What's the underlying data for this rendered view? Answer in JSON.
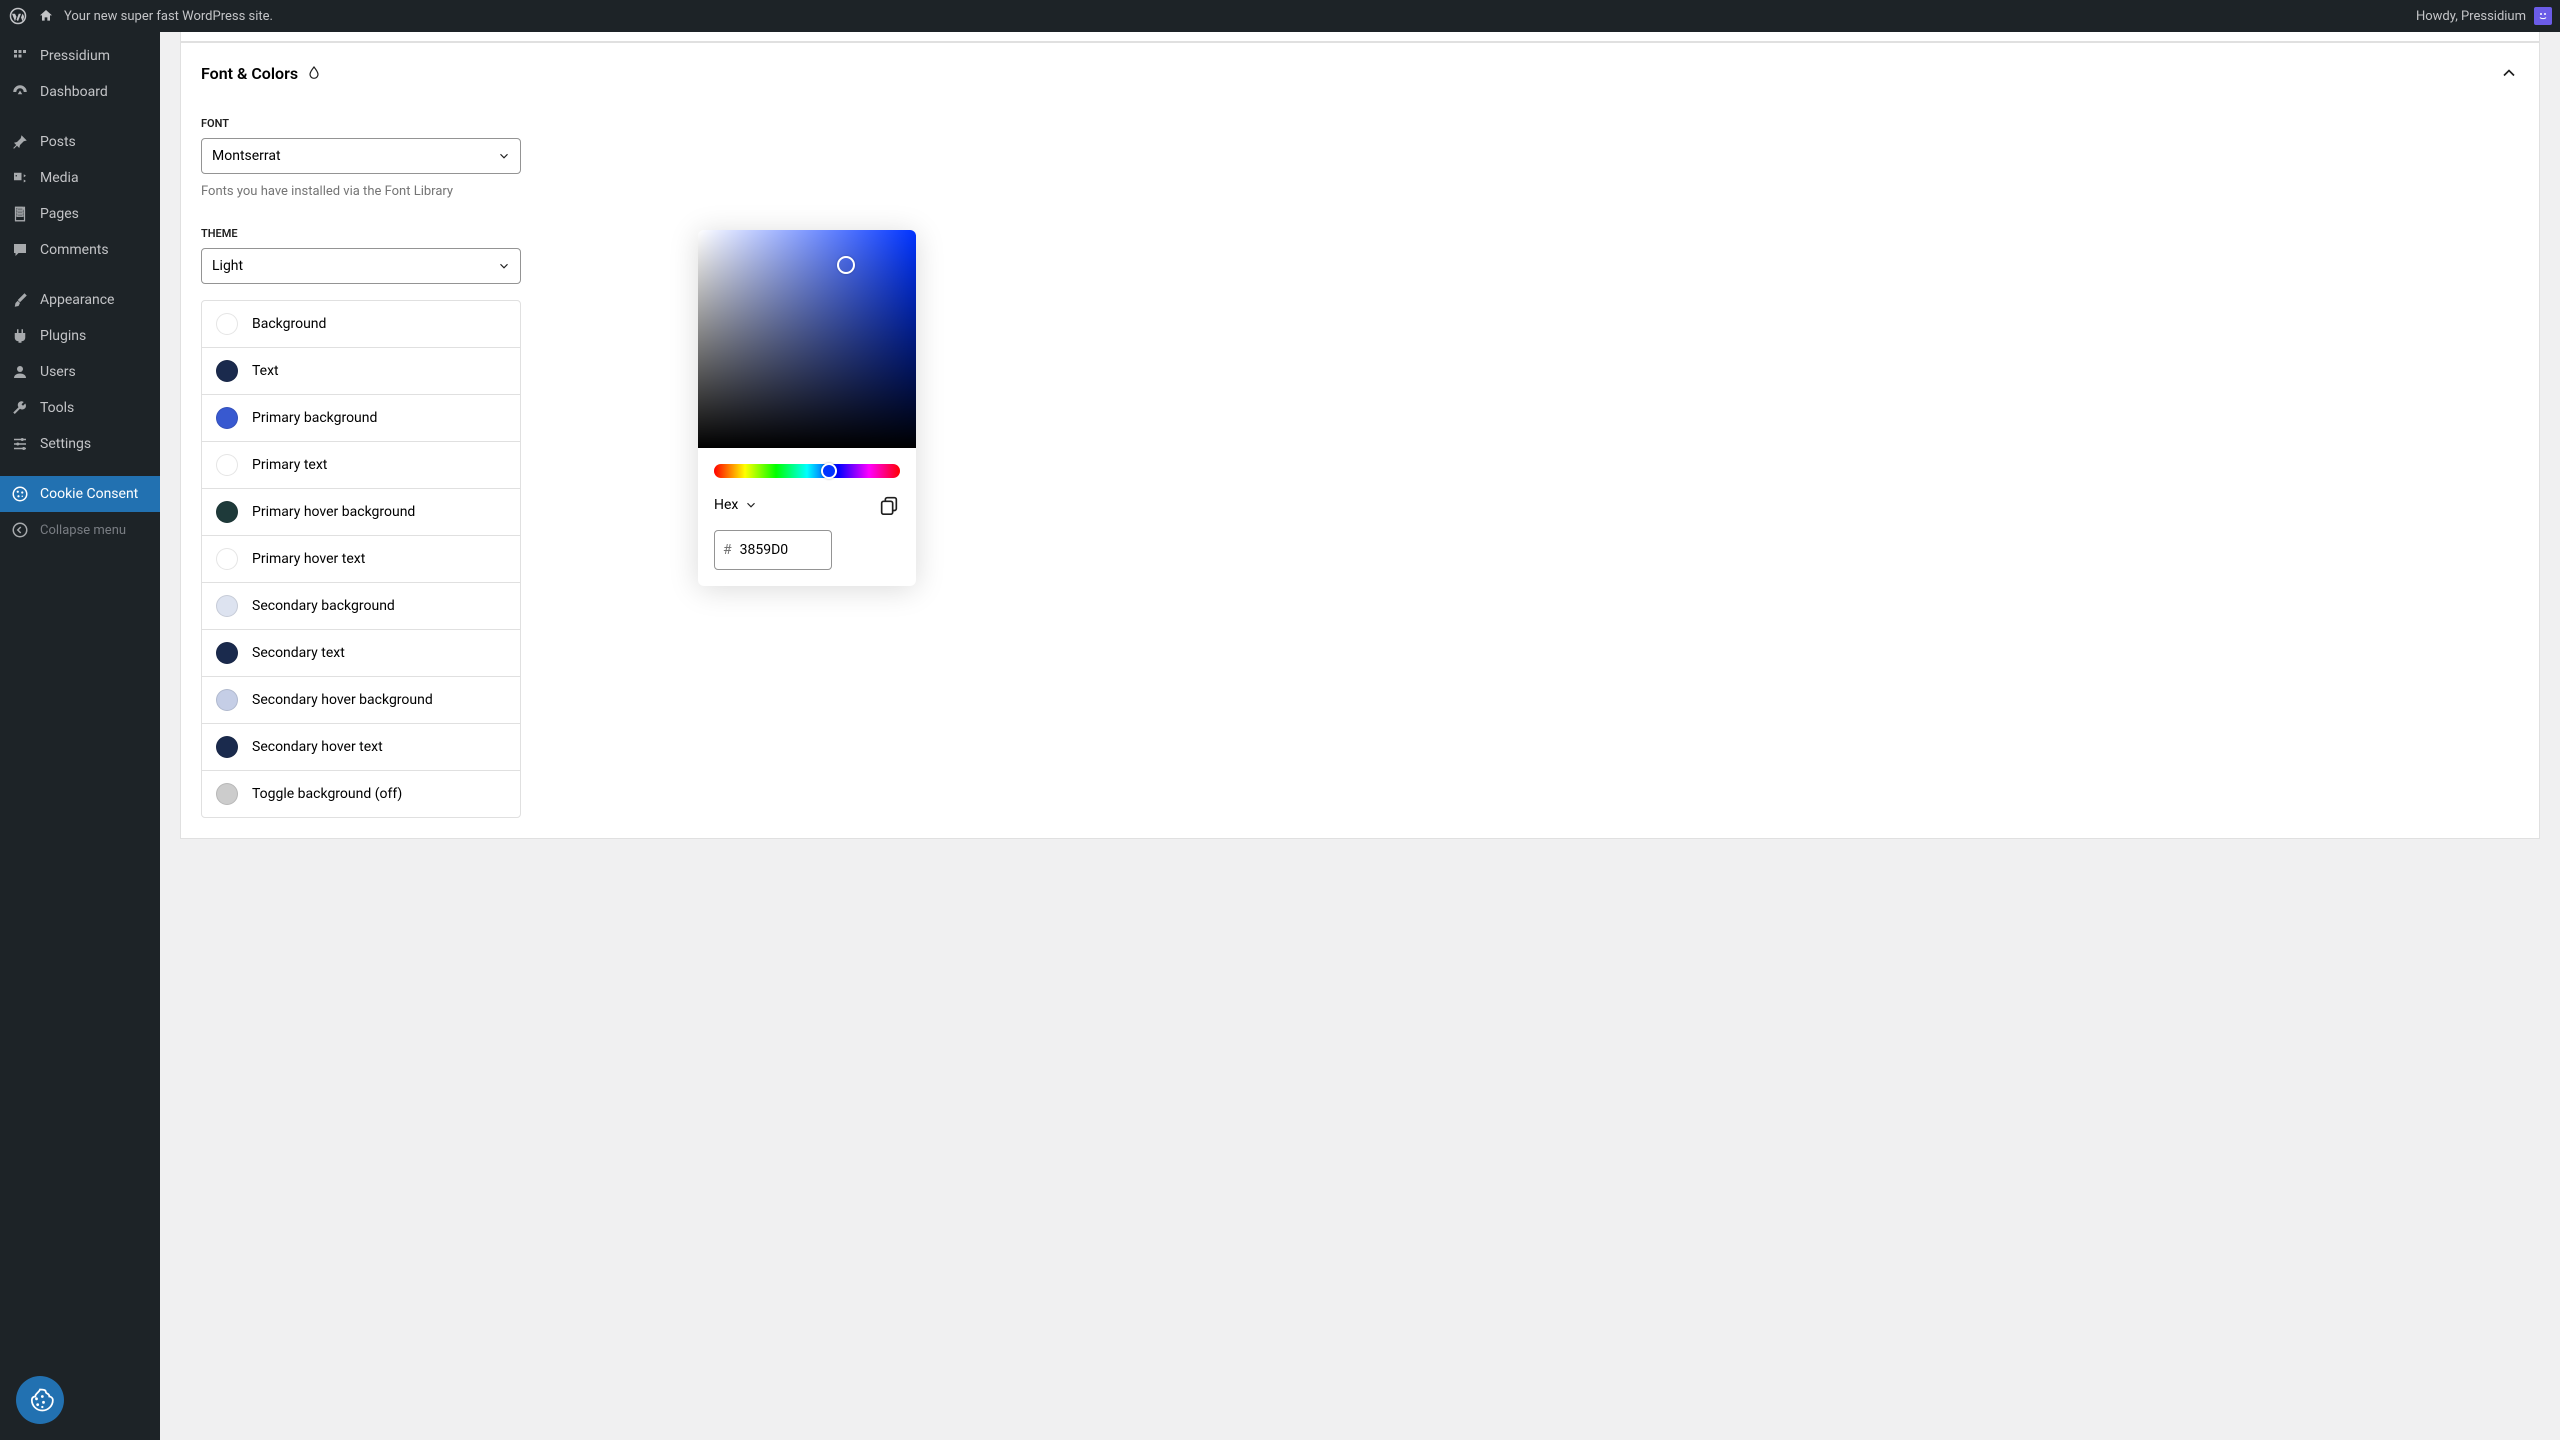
{
  "adminbar": {
    "site_title": "Your new super fast WordPress site.",
    "greeting": "Howdy, Pressidium"
  },
  "sidebar": {
    "items": [
      {
        "label": "Pressidium",
        "icon": "pressidium"
      },
      {
        "label": "Dashboard",
        "icon": "dashboard"
      },
      {
        "label": "Posts",
        "icon": "pin"
      },
      {
        "label": "Media",
        "icon": "media"
      },
      {
        "label": "Pages",
        "icon": "page"
      },
      {
        "label": "Comments",
        "icon": "comment"
      },
      {
        "label": "Appearance",
        "icon": "brush"
      },
      {
        "label": "Plugins",
        "icon": "plugin"
      },
      {
        "label": "Users",
        "icon": "user"
      },
      {
        "label": "Tools",
        "icon": "wrench"
      },
      {
        "label": "Settings",
        "icon": "sliders"
      },
      {
        "label": "Cookie Consent",
        "icon": "cookie",
        "active": true
      },
      {
        "label": "Collapse menu",
        "icon": "collapse",
        "collapse": true
      }
    ]
  },
  "panel": {
    "title": "Font & Colors",
    "font_label": "FONT",
    "font_value": "Montserrat",
    "font_help": "Fonts you have installed via the Font Library",
    "theme_label": "THEME",
    "theme_value": "Light",
    "colors": [
      {
        "label": "Background",
        "hex": "#ffffff"
      },
      {
        "label": "Text",
        "hex": "#1a2a4d"
      },
      {
        "label": "Primary background",
        "hex": "#3859D0"
      },
      {
        "label": "Primary text",
        "hex": "#ffffff"
      },
      {
        "label": "Primary hover background",
        "hex": "#1e3a3a"
      },
      {
        "label": "Primary hover text",
        "hex": "#ffffff"
      },
      {
        "label": "Secondary background",
        "hex": "#dde3f0"
      },
      {
        "label": "Secondary text",
        "hex": "#1a2a4d"
      },
      {
        "label": "Secondary hover background",
        "hex": "#c5cee6"
      },
      {
        "label": "Secondary hover text",
        "hex": "#1a2a4d"
      },
      {
        "label": "Toggle background (off)",
        "hex": "#cccccc"
      }
    ]
  },
  "picker": {
    "format": "Hex",
    "value": "3859D0"
  }
}
